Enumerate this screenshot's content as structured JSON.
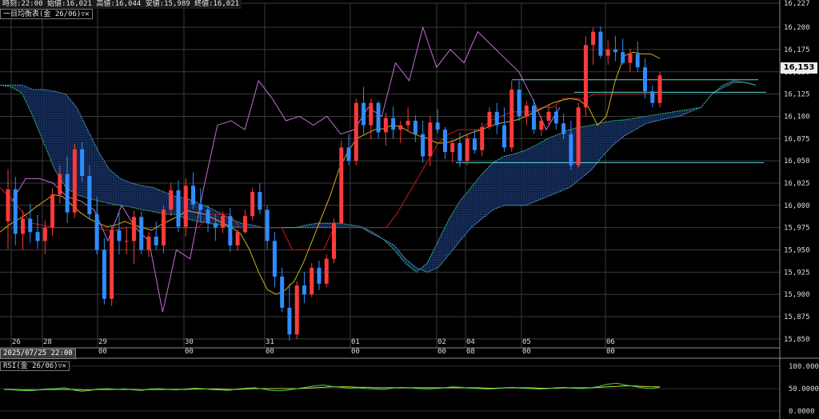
{
  "info_bar": {
    "time_label": "時刻",
    "time_value": "22:00",
    "open_label": "始値",
    "open_value": "16,021",
    "high_label": "高値",
    "high_value": "16,044",
    "low_label": "安値",
    "low_value": "15,989",
    "close_label": "終値",
    "close_value": "16,021"
  },
  "indicator_label": "一目均衡表(金 26/06)",
  "rsi_label": "RSI(金 26/06)",
  "cursor_date": "2025/07/25 22:00",
  "current_price": "16,153",
  "colors": {
    "up_candle": "#ff3a3a",
    "down_candle": "#2f8cff",
    "tenkan": "#d4b018",
    "kijun": "#d01818",
    "chikou": "#c26fd0",
    "senkou_a": "#3fbf7f",
    "senkou_b": "#4aa8c8",
    "hline": "#5fd6d6",
    "rsi_main": "#3fd43f",
    "rsi_signal": "#d4d43f"
  },
  "chart_data": {
    "type": "candlestick",
    "ylim": [
      15840,
      16227
    ],
    "price_ticks": [
      "16,227",
      "16,200",
      "16,175",
      "16,150",
      "16,125",
      "16,100",
      "16,075",
      "16,050",
      "16,025",
      "16,000",
      "15,975",
      "15,950",
      "15,925",
      "15,900",
      "15,875",
      "15,850"
    ],
    "date_labels": [
      {
        "day": "26",
        "time": ""
      },
      {
        "day": "28",
        "time": ""
      },
      {
        "day": "29",
        "time": "00"
      },
      {
        "day": "30",
        "time": "00"
      },
      {
        "day": "31",
        "time": "00"
      },
      {
        "day": "01",
        "time": "00"
      },
      {
        "day": "02",
        "time": "00"
      },
      {
        "day": "04",
        "time": "08"
      },
      {
        "day": "05",
        "time": "00"
      },
      {
        "day": "06",
        "time": "00"
      }
    ],
    "candles": [
      [
        15982,
        16040,
        15951,
        16018
      ],
      [
        16018,
        16032,
        15955,
        15968
      ],
      [
        15968,
        15994,
        15950,
        15985
      ],
      [
        15985,
        16002,
        15958,
        15970
      ],
      [
        15970,
        15989,
        15951,
        15960
      ],
      [
        15960,
        15983,
        15945,
        15975
      ],
      [
        15975,
        16019,
        15966,
        16012
      ],
      [
        16012,
        16045,
        16002,
        16035
      ],
      [
        16035,
        16055,
        15980,
        15992
      ],
      [
        15992,
        16069,
        15986,
        16063
      ],
      [
        16063,
        16071,
        16026,
        16033
      ],
      [
        16033,
        16045,
        15985,
        15990
      ],
      [
        15990,
        16010,
        15945,
        15950
      ],
      [
        15950,
        15963,
        15889,
        15895
      ],
      [
        15895,
        15978,
        15887,
        15972
      ],
      [
        15972,
        15992,
        15945,
        15960
      ],
      [
        15960,
        15976,
        15945,
        15960
      ],
      [
        15960,
        15994,
        15934,
        15987
      ],
      [
        15987,
        15993,
        15945,
        15950
      ],
      [
        15950,
        15970,
        15942,
        15965
      ],
      [
        15965,
        15982,
        15950,
        15955
      ],
      [
        15955,
        16000,
        15946,
        15995
      ],
      [
        15995,
        16025,
        15988,
        16017
      ],
      [
        16017,
        16028,
        15970,
        15976
      ],
      [
        15976,
        16030,
        15965,
        16022
      ],
      [
        16022,
        16037,
        15996,
        16001
      ],
      [
        16001,
        16019,
        15981,
        15995
      ],
      [
        15995,
        16000,
        15970,
        15980
      ],
      [
        15980,
        15990,
        15960,
        15975
      ],
      [
        15975,
        15993,
        15969,
        15988
      ],
      [
        15988,
        15997,
        15948,
        15955
      ],
      [
        15955,
        15973,
        15949,
        15970
      ],
      [
        15970,
        15995,
        15968,
        15988
      ],
      [
        15988,
        16020,
        15983,
        16015
      ],
      [
        16015,
        16025,
        15990,
        15995
      ],
      [
        15995,
        16000,
        15950,
        15960
      ],
      [
        15960,
        15970,
        15908,
        15920
      ],
      [
        15920,
        15930,
        15880,
        15885
      ],
      [
        15885,
        15912,
        15848,
        15855
      ],
      [
        15855,
        15915,
        15850,
        15910
      ],
      [
        15910,
        15925,
        15890,
        15900
      ],
      [
        15900,
        15935,
        15897,
        15930
      ],
      [
        15930,
        15938,
        15905,
        15912
      ],
      [
        15912,
        15945,
        15908,
        15940
      ],
      [
        15940,
        15985,
        15935,
        15980
      ],
      [
        15980,
        16073,
        16000,
        16065
      ],
      [
        16065,
        16080,
        16045,
        16050
      ],
      [
        16050,
        16120,
        16045,
        16115
      ],
      [
        16115,
        16133,
        16080,
        16090
      ],
      [
        16090,
        16120,
        16074,
        16115
      ],
      [
        16115,
        16117,
        16075,
        16082
      ],
      [
        16082,
        16104,
        16067,
        16098
      ],
      [
        16098,
        16111,
        16075,
        16085
      ],
      [
        16085,
        16095,
        16070,
        16090
      ],
      [
        16090,
        16110,
        16083,
        16095
      ],
      [
        16095,
        16101,
        16071,
        16080
      ],
      [
        16080,
        16095,
        16048,
        16055
      ],
      [
        16055,
        16100,
        16044,
        16093
      ],
      [
        16093,
        16108,
        16081,
        16085
      ],
      [
        16085,
        16088,
        16052,
        16060
      ],
      [
        16060,
        16074,
        16048,
        16070
      ],
      [
        16070,
        16082,
        16043,
        16050
      ],
      [
        16050,
        16080,
        16045,
        16075
      ],
      [
        16075,
        16085,
        16058,
        16062
      ],
      [
        16062,
        16093,
        16055,
        16088
      ],
      [
        16088,
        16110,
        16085,
        16105
      ],
      [
        16105,
        16115,
        16080,
        16090
      ],
      [
        16090,
        16110,
        16060,
        16065
      ],
      [
        16065,
        16140,
        16060,
        16130
      ],
      [
        16130,
        16140,
        16095,
        16100
      ],
      [
        16100,
        16117,
        16090,
        16112
      ],
      [
        16112,
        16119,
        16080,
        16085
      ],
      [
        16085,
        16100,
        16078,
        16095
      ],
      [
        16095,
        16114,
        16090,
        16105
      ],
      [
        16105,
        16111,
        16085,
        16092
      ],
      [
        16092,
        16103,
        16074,
        16080
      ],
      [
        16080,
        16095,
        16040,
        16045
      ],
      [
        16045,
        16115,
        16042,
        16110
      ],
      [
        16110,
        16190,
        16100,
        16180
      ],
      [
        16180,
        16200,
        16158,
        16195
      ],
      [
        16195,
        16201,
        16165,
        16168
      ],
      [
        16168,
        16185,
        16158,
        16175
      ],
      [
        16175,
        16190,
        16162,
        16172
      ],
      [
        16172,
        16187,
        16158,
        16160
      ],
      [
        16160,
        16176,
        16150,
        16170
      ],
      [
        16170,
        16184,
        16150,
        16155
      ],
      [
        16155,
        16165,
        16120,
        16128
      ],
      [
        16128,
        16135,
        16110,
        16115
      ],
      [
        16115,
        16150,
        16110,
        16146
      ]
    ],
    "tenkan": [
      15970,
      15978,
      15984,
      15990,
      15998,
      16005,
      16012,
      16010,
      16001,
      15992,
      15985,
      15980,
      15976,
      15978,
      15982,
      15978,
      15975,
      15972,
      15978,
      15983,
      15988,
      15994,
      15992,
      15990,
      15985,
      15980,
      15975,
      15968,
      15950,
      15925,
      15905,
      15900,
      15905,
      15915,
      15935,
      15960,
      15985,
      16010,
      16040,
      16060,
      16075,
      16080,
      16085,
      16086,
      16090,
      16088,
      16082,
      16078,
      16075,
      16070,
      16070,
      16073,
      16078,
      16082,
      16085,
      16089,
      16092,
      16094,
      16096,
      16100,
      16105,
      16110,
      16115,
      16118,
      16120,
      16118,
      16110,
      16090,
      16100,
      16140,
      16168,
      16172,
      16170,
      16170,
      16165
    ],
    "kijun": [
      16020,
      16008,
      15995,
      15980,
      15978,
      15975,
      15975,
      15975,
      15975,
      15975,
      15972,
      15972,
      15975,
      15975,
      15975,
      15975,
      15975,
      15975,
      15975,
      15975,
      15990,
      15990,
      15990,
      15975,
      15975,
      15975,
      15975,
      15975,
      15950,
      15950,
      15950,
      15950,
      15975,
      15975,
      15975,
      15975,
      15975,
      15975,
      15990,
      16010,
      16030,
      16050,
      16070,
      16080,
      16085,
      16085,
      16085,
      16095,
      16100,
      16105,
      16105,
      16105,
      16110,
      16110,
      16120,
      16120,
      16120,
      16125,
      16125,
      16125,
      16125,
      16125,
      16125,
      16125
    ],
    "senkou_a": [
      16135,
      16133,
      16126,
      16100,
      16070,
      16040,
      16020,
      16012,
      16008,
      16005,
      16002,
      16000,
      15998,
      15995,
      15993,
      15990,
      15990,
      15985,
      15982,
      15980,
      15978,
      15976,
      15975,
      15975,
      15975,
      15975,
      15975,
      15975,
      15978,
      15980,
      15980,
      15980,
      15978,
      15976,
      15970,
      15962,
      15950,
      15935,
      15925,
      15935,
      15960,
      15985,
      16005,
      16020,
      16035,
      16048,
      16055,
      16058,
      16062,
      16068,
      16075,
      16080,
      16085,
      16088,
      16090,
      16093,
      16095,
      16096,
      16098,
      16100,
      16102,
      16104,
      16106,
      16108,
      16110,
      16125,
      16135,
      16140,
      16138,
      16135
    ],
    "senkou_b": [
      16135,
      16135,
      16135,
      16130,
      16130,
      16128,
      16125,
      16110,
      16085,
      16060,
      16040,
      16030,
      16025,
      16022,
      16020,
      16015,
      16010,
      16008,
      16003,
      15998,
      15992,
      15985,
      15980,
      15978,
      15975,
      15975,
      15975,
      15975,
      15975,
      15975,
      15975,
      15975,
      15975,
      15975,
      15968,
      15962,
      15955,
      15940,
      15930,
      15925,
      15930,
      15945,
      15960,
      15975,
      15985,
      15995,
      16000,
      16000,
      16000,
      16005,
      16010,
      16015,
      16020,
      16030,
      16040,
      16055,
      16068,
      16078,
      16085,
      16092,
      16095,
      16098,
      16100,
      16105,
      16110,
      16125,
      16132,
      16138,
      16138,
      16135
    ],
    "chikou": [
      16005,
      16030,
      16030,
      16025,
      16010,
      16005,
      15995,
      15960,
      16000,
      15975,
      15960,
      15880,
      15950,
      15940,
      16020,
      16090,
      16095,
      16085,
      16140,
      16120,
      16095,
      16100,
      16090,
      16100,
      16080,
      16085,
      16110,
      16100,
      16160,
      16140,
      16200,
      16155,
      16175,
      16160,
      16195,
      16180,
      16165,
      16150,
      16120,
      16085,
      16110
    ],
    "hlines": [
      16141,
      16127,
      16048
    ],
    "rsi": {
      "axis_labels": [
        "100.0000",
        "50.0000",
        "0.0000"
      ],
      "ylim": [
        0,
        100
      ],
      "main": [
        48,
        47,
        46,
        45,
        47,
        49,
        50,
        52,
        47,
        44,
        46,
        49,
        50,
        48,
        49,
        47,
        46,
        49,
        50,
        48,
        47,
        49,
        51,
        50,
        48,
        47,
        46,
        49,
        51,
        52,
        49,
        46,
        45,
        47,
        50,
        53,
        56,
        58,
        55,
        53,
        51,
        52,
        50,
        49,
        48,
        51,
        53,
        52,
        50,
        49,
        50,
        52,
        54,
        53,
        51,
        50,
        49,
        50,
        52,
        53,
        51,
        50,
        49,
        50,
        52,
        53,
        51,
        50,
        52,
        55,
        60,
        62,
        58,
        55,
        52,
        50,
        53
      ],
      "signal": [
        48,
        48,
        47,
        47,
        47,
        48,
        48,
        48,
        48,
        47,
        47,
        48,
        48,
        48,
        48,
        48,
        47,
        48,
        48,
        48,
        48,
        48,
        49,
        49,
        49,
        49,
        48,
        48,
        49,
        50,
        50,
        50,
        50,
        50,
        50,
        51,
        52,
        53,
        54,
        54,
        54,
        53,
        53,
        52,
        52,
        52,
        52,
        52,
        52,
        52,
        52,
        52,
        52,
        52,
        52,
        52,
        51,
        51,
        52,
        52,
        52,
        52,
        51,
        51,
        51,
        52,
        52,
        52,
        52,
        53,
        54,
        55,
        56,
        56,
        55,
        54,
        54
      ]
    }
  }
}
